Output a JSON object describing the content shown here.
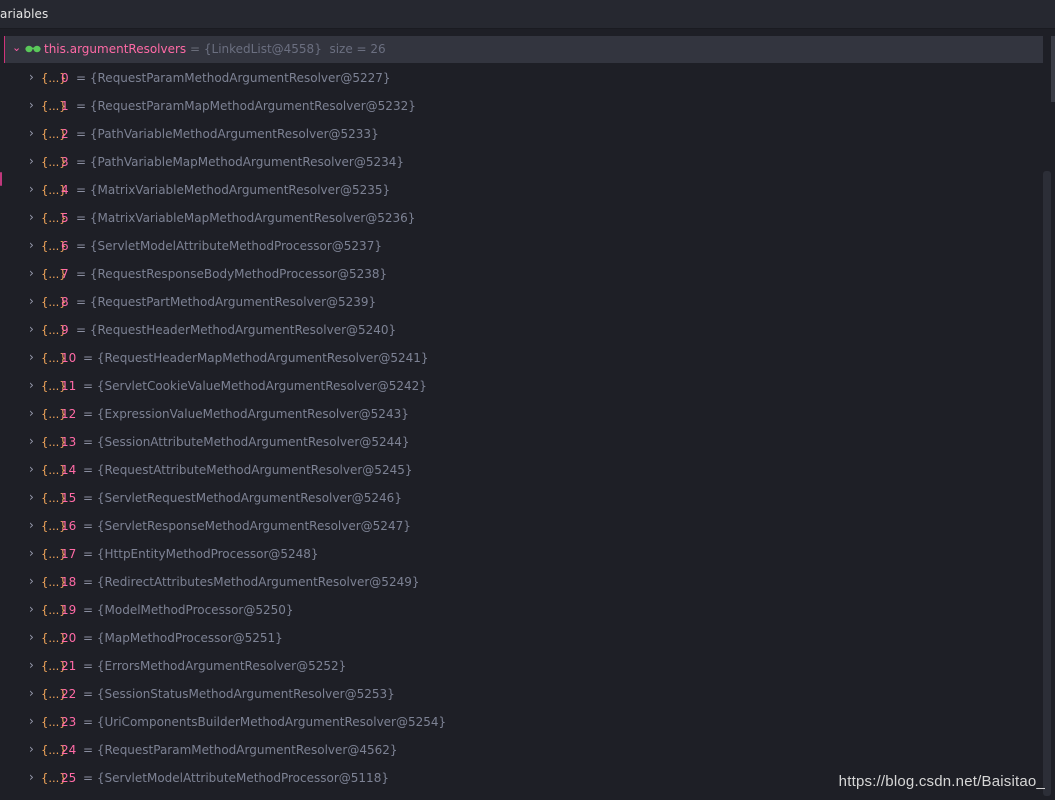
{
  "header": {
    "title": "ariables"
  },
  "root": {
    "name": "this.argumentResolvers",
    "value": "{LinkedList@4558}",
    "size": "size = 26",
    "icon": "glasses-icon"
  },
  "items": [
    {
      "index": "0",
      "value": "{RequestParamMethodArgumentResolver@5227}"
    },
    {
      "index": "1",
      "value": "{RequestParamMapMethodArgumentResolver@5232}"
    },
    {
      "index": "2",
      "value": "{PathVariableMethodArgumentResolver@5233}"
    },
    {
      "index": "3",
      "value": "{PathVariableMapMethodArgumentResolver@5234}"
    },
    {
      "index": "4",
      "value": "{MatrixVariableMethodArgumentResolver@5235}"
    },
    {
      "index": "5",
      "value": "{MatrixVariableMapMethodArgumentResolver@5236}"
    },
    {
      "index": "6",
      "value": "{ServletModelAttributeMethodProcessor@5237}"
    },
    {
      "index": "7",
      "value": "{RequestResponseBodyMethodProcessor@5238}"
    },
    {
      "index": "8",
      "value": "{RequestPartMethodArgumentResolver@5239}"
    },
    {
      "index": "9",
      "value": "{RequestHeaderMethodArgumentResolver@5240}"
    },
    {
      "index": "10",
      "value": "{RequestHeaderMapMethodArgumentResolver@5241}"
    },
    {
      "index": "11",
      "value": "{ServletCookieValueMethodArgumentResolver@5242}"
    },
    {
      "index": "12",
      "value": "{ExpressionValueMethodArgumentResolver@5243}"
    },
    {
      "index": "13",
      "value": "{SessionAttributeMethodArgumentResolver@5244}"
    },
    {
      "index": "14",
      "value": "{RequestAttributeMethodArgumentResolver@5245}"
    },
    {
      "index": "15",
      "value": "{ServletRequestMethodArgumentResolver@5246}"
    },
    {
      "index": "16",
      "value": "{ServletResponseMethodArgumentResolver@5247}"
    },
    {
      "index": "17",
      "value": "{HttpEntityMethodProcessor@5248}"
    },
    {
      "index": "18",
      "value": "{RedirectAttributesMethodArgumentResolver@5249}"
    },
    {
      "index": "19",
      "value": "{ModelMethodProcessor@5250}"
    },
    {
      "index": "20",
      "value": "{MapMethodProcessor@5251}"
    },
    {
      "index": "21",
      "value": "{ErrorsMethodArgumentResolver@5252}"
    },
    {
      "index": "22",
      "value": "{SessionStatusMethodArgumentResolver@5253}"
    },
    {
      "index": "23",
      "value": "{UriComponentsBuilderMethodArgumentResolver@5254}"
    },
    {
      "index": "24",
      "value": "{RequestParamMethodArgumentResolver@4562}"
    },
    {
      "index": "25",
      "value": "{ServletModelAttributeMethodProcessor@5118}"
    }
  ],
  "item_prefix": "{...}",
  "watermark": "https://blog.csdn.net/Baisitao_",
  "colors": {
    "background": "#1e1f26",
    "selected_row": "#33353f",
    "name_pink": "#ff6aa6",
    "brace_orange": "#f3a65a",
    "value_gray": "#7d8294",
    "glasses_green": "#5ac85a"
  }
}
